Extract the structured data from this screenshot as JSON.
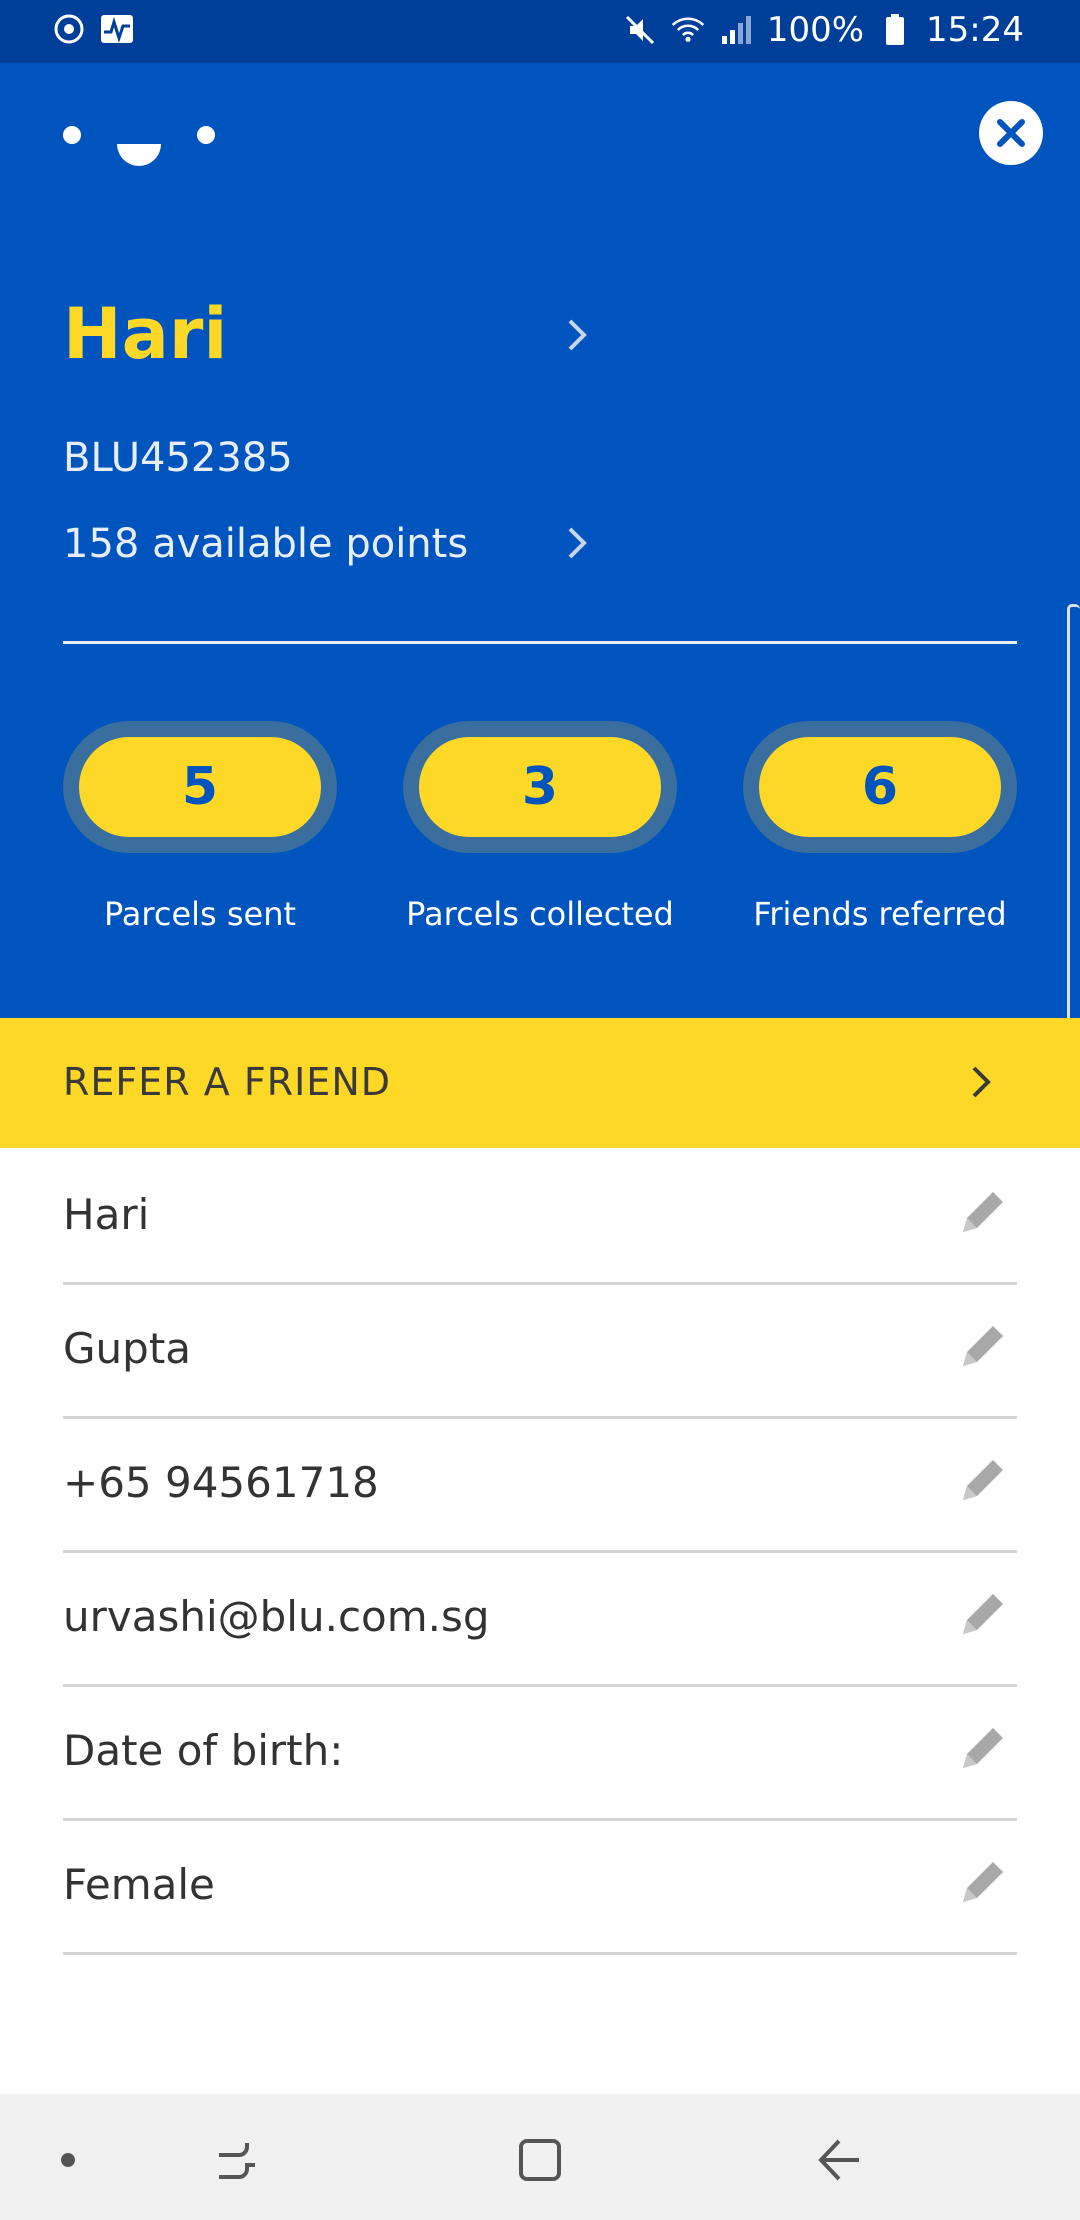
{
  "status_bar": {
    "battery": "100%",
    "time": "15:24"
  },
  "profile": {
    "name": "Hari",
    "member_id": "BLU452385",
    "points_text": "158 available points"
  },
  "stats": [
    {
      "value": "5",
      "label": "Parcels sent"
    },
    {
      "value": "3",
      "label": "Parcels collected"
    },
    {
      "value": "6",
      "label": "Friends referred"
    }
  ],
  "refer": {
    "label": "REFER A FRIEND"
  },
  "fields": [
    {
      "value": "Hari"
    },
    {
      "value": "Gupta"
    },
    {
      "value": "+65 94561718"
    },
    {
      "value": "urvashi@blu.com.sg"
    },
    {
      "value": "Date of birth:"
    },
    {
      "value": "Female"
    }
  ],
  "colors": {
    "brand_blue": "#0054bd",
    "brand_yellow": "#fdd826",
    "status_bar": "#003f99"
  },
  "icons": [
    "sync-icon",
    "activity-icon",
    "mute-icon",
    "wifi-icon",
    "signal-icon",
    "battery-icon",
    "close-icon",
    "chevron-right-icon",
    "pencil-icon",
    "recent-apps-icon",
    "home-icon",
    "back-icon"
  ]
}
